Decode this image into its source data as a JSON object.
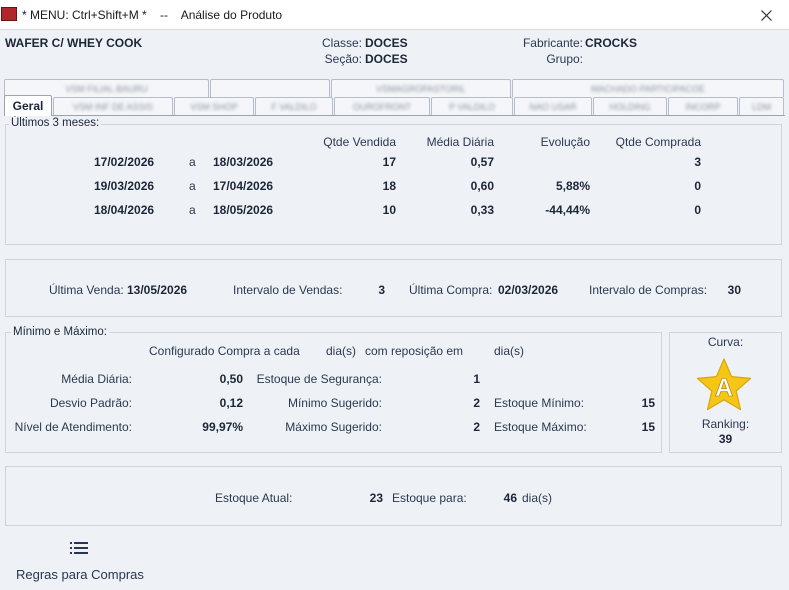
{
  "window": {
    "title": "* MENU: Ctrl+Shift+M *    --    Análise do Produto",
    "accent": "#b0262b"
  },
  "header": {
    "product_name": "WAFER C/ WHEY COOK",
    "classe_label": "Classe:",
    "classe_value": "DOCES",
    "secao_label": "Seção:",
    "secao_value": "DOCES",
    "fabricante_label": "Fabricante:",
    "fabricante_value": "CROCKS",
    "grupo_label": "Grupo:",
    "grupo_value": ""
  },
  "tabs_top": [
    "VSM FILIAL BAURU",
    "",
    "VSMAGROPASTORIL",
    "MACHADO PARTICIPACOE"
  ],
  "tabs_bottom": [
    "Geral",
    "VSM INF DE ASSIS",
    "VSM SHOP",
    "F VALDILO",
    "OUROFRONT",
    "P VALDILO",
    "NAO USAR",
    "HOLDING",
    "INCORP",
    "LDM"
  ],
  "ultimos": {
    "title": "Últimos 3 meses:",
    "headers": [
      "Qtde Vendida",
      "Média Diária",
      "Evolução",
      "Qtde Comprada"
    ],
    "separator": "a",
    "rows": [
      {
        "from": "17/02/2026",
        "to": "18/03/2026",
        "qtde_vendida": "17",
        "media_diaria": "0,57",
        "evolucao": "",
        "qtde_comprada": "3"
      },
      {
        "from": "19/03/2026",
        "to": "17/04/2026",
        "qtde_vendida": "18",
        "media_diaria": "0,60",
        "evolucao": "5,88%",
        "qtde_comprada": "0"
      },
      {
        "from": "18/04/2026",
        "to": "18/05/2026",
        "qtde_vendida": "10",
        "media_diaria": "0,33",
        "evolucao": "-44,44%",
        "qtde_comprada": "0"
      }
    ]
  },
  "vendas": {
    "ultima_venda_label": "Última Venda:",
    "ultima_venda_value": "13/05/2026",
    "intervalo_vendas_label": "Intervalo de Vendas:",
    "intervalo_vendas_value": "3",
    "ultima_compra_label": "Última Compra:",
    "ultima_compra_value": "02/03/2026",
    "intervalo_compras_label": "Intervalo de Compras:",
    "intervalo_compras_value": "30"
  },
  "minmax": {
    "title": "Mínimo e Máximo:",
    "config_text": "Configurado Compra a cada",
    "dias_1": "dia(s)",
    "reposicao_text": "com reposição em",
    "dias_2": "dia(s)",
    "media_diaria_label": "Média Diária:",
    "media_diaria_value": "0,50",
    "desvio_label": "Desvio Padrão:",
    "desvio_value": "0,12",
    "nivel_label": "Nível de Atendimento:",
    "nivel_value": "99,97%",
    "estoque_seg_label": "Estoque de Segurança:",
    "estoque_seg_value": "1",
    "min_sug_label": "Mínimo Sugerido:",
    "min_sug_value": "2",
    "max_sug_label": "Máximo Sugerido:",
    "max_sug_value": "2",
    "estoque_min_label": "Estoque Mínimo:",
    "estoque_min_value": "15",
    "estoque_max_label": "Estoque Máximo:",
    "estoque_max_value": "15"
  },
  "curva": {
    "label": "Curva:",
    "letter": "A",
    "ranking_label": "Ranking:",
    "ranking_value": "39",
    "star_color": "#f5c518",
    "letter_color": "#ffffff"
  },
  "estoque": {
    "atual_label": "Estoque Atual:",
    "atual_value": "23",
    "para_label": "Estoque para:",
    "para_value": "46",
    "para_unit": "dia(s)"
  },
  "footer": {
    "icon": "list-icon",
    "label": "Regras para Compras"
  }
}
